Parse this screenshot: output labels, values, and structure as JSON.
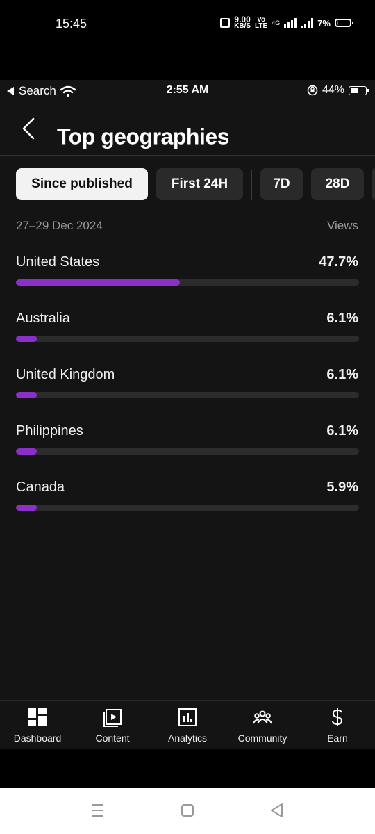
{
  "android_status": {
    "time": "15:45",
    "net_speed_value": "9.00",
    "net_speed_unit": "KB/S",
    "volte_top": "Vo",
    "volte_bottom": "LTE",
    "network_type": "4G",
    "battery_percent": "7%"
  },
  "ios_status": {
    "back_app": "Search",
    "time": "2:55 AM",
    "battery_percent": "44%"
  },
  "header": {
    "title": "Top geographies"
  },
  "tabs": [
    {
      "label": "Since published",
      "active": true
    },
    {
      "label": "First 24H",
      "active": false
    },
    {
      "label": "7D",
      "active": false
    },
    {
      "label": "28D",
      "active": false
    }
  ],
  "meta": {
    "date_range": "27–29 Dec 2024",
    "metric_label": "Views"
  },
  "geographies": [
    {
      "country": "United States",
      "percent_label": "47.7%",
      "value": 47.7
    },
    {
      "country": "Australia",
      "percent_label": "6.1%",
      "value": 6.1
    },
    {
      "country": "United Kingdom",
      "percent_label": "6.1%",
      "value": 6.1
    },
    {
      "country": "Philippines",
      "percent_label": "6.1%",
      "value": 6.1
    },
    {
      "country": "Canada",
      "percent_label": "5.9%",
      "value": 5.9
    }
  ],
  "bottom_nav": [
    {
      "label": "Dashboard",
      "icon": "dashboard-icon"
    },
    {
      "label": "Content",
      "icon": "content-icon"
    },
    {
      "label": "Analytics",
      "icon": "analytics-icon"
    },
    {
      "label": "Community",
      "icon": "community-icon"
    },
    {
      "label": "Earn",
      "icon": "earn-icon"
    }
  ],
  "colors": {
    "accent_bar": "#8b2fc9",
    "background": "#141414",
    "tab_active_bg": "#f2f2f2",
    "tab_bg": "#2a2a2a"
  }
}
